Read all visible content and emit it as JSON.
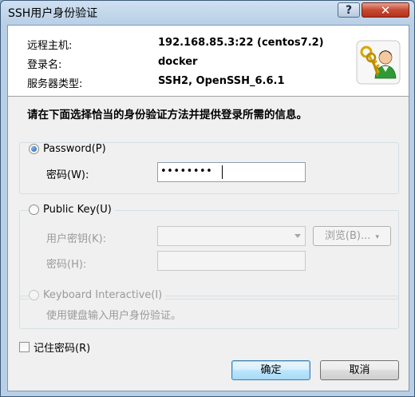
{
  "window": {
    "title": "SSH用户身份验证",
    "help_label": "?",
    "close_label": "✕"
  },
  "header": {
    "host_label": "远程主机:",
    "host_value": "192.168.85.3:22 (centos7.2)",
    "login_label": "登录名:",
    "login_value": "docker",
    "server_type_label": "服务器类型:",
    "server_type_value": "SSH2, OpenSSH_6.6.1",
    "icon": "keys-user-icon"
  },
  "instruction": "请在下面选择恰当的身份验证方法并提供登录所需的信息。",
  "password_method": {
    "label": "Password(P)",
    "selected": true,
    "field_label": "密码(W):",
    "field_value": "••••••••"
  },
  "public_key_method": {
    "label": "Public Key(U)",
    "selected": false,
    "user_key_label": "用户密钥(K):",
    "user_key_value": "",
    "browse_label": "浏览(B)...",
    "passphrase_label": "密码(H):",
    "passphrase_value": ""
  },
  "keyboard_method": {
    "label": "Keyboard Interactive(I)",
    "selected": false,
    "description": "使用键盘输入用户身份验证。"
  },
  "remember_password": {
    "label": "记住密码(R)",
    "checked": false
  },
  "buttons": {
    "ok": "确定",
    "cancel": "取消"
  }
}
